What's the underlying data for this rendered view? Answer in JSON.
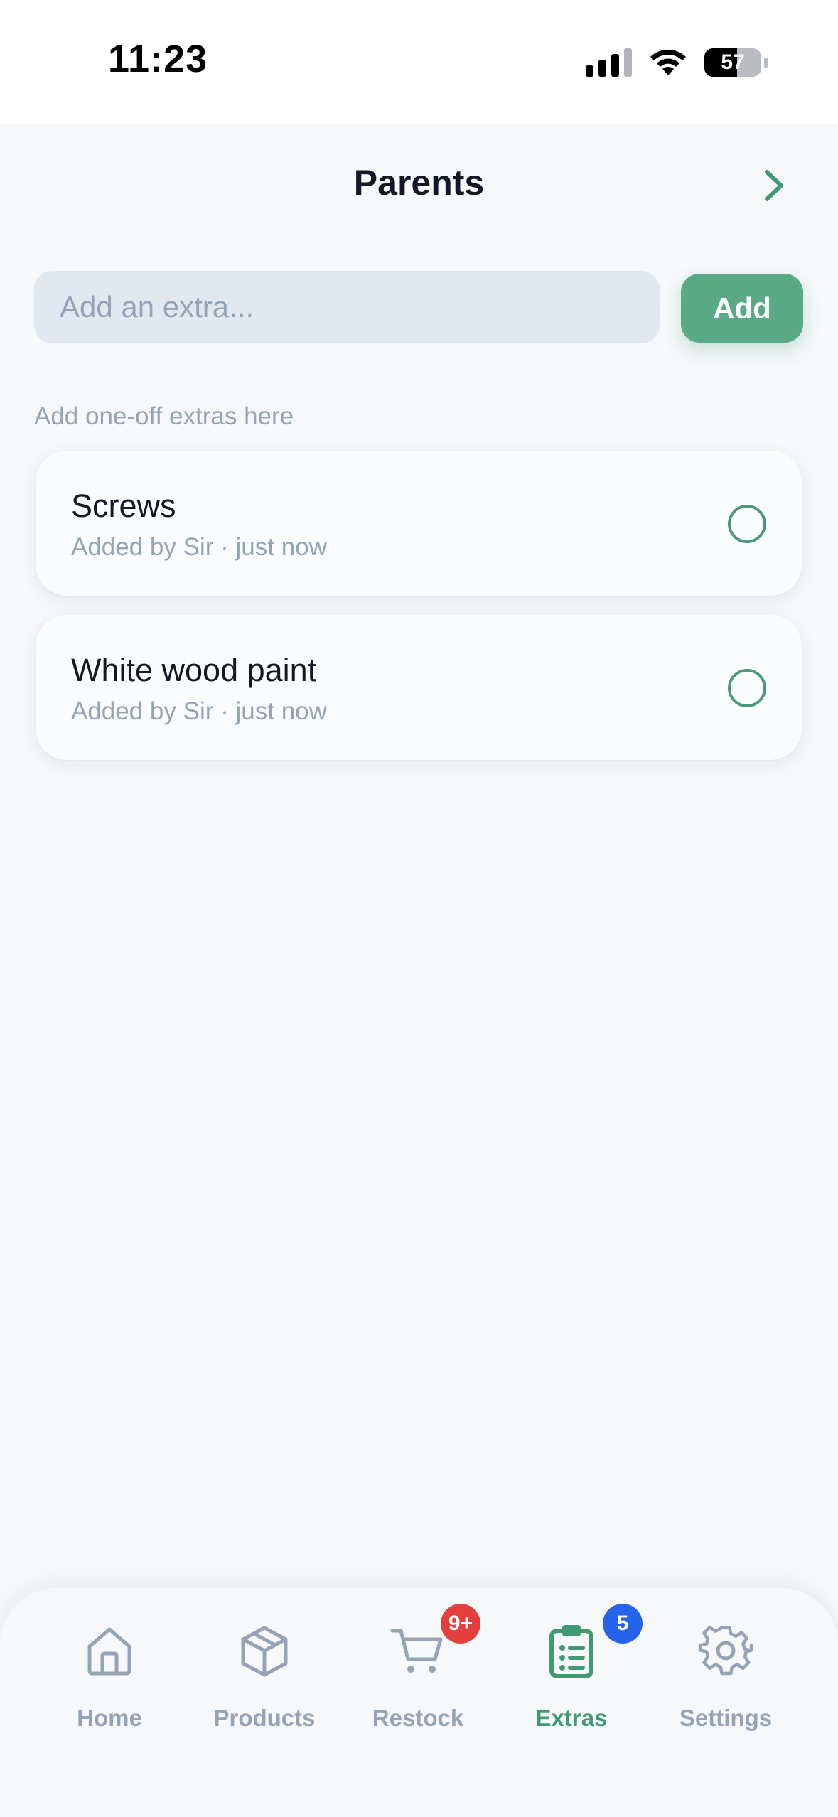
{
  "status_bar": {
    "time": "11:23",
    "battery": "57",
    "battery_level": 0.57
  },
  "header": {
    "title": "Parents"
  },
  "add_extra": {
    "placeholder": "Add an extra...",
    "button_label": "Add"
  },
  "hint": "Add one-off extras here",
  "extras": [
    {
      "name": "Screws",
      "meta": "Added by Sir · just now",
      "done": false
    },
    {
      "name": "White wood paint",
      "meta": "Added by Sir · just now",
      "done": false
    }
  ],
  "tabs": [
    {
      "label": "Home",
      "icon": "home-icon",
      "active": false,
      "badge": ""
    },
    {
      "label": "Products",
      "icon": "box-icon",
      "active": false,
      "badge": ""
    },
    {
      "label": "Restock",
      "icon": "cart-icon",
      "active": false,
      "badge": "9+"
    },
    {
      "label": "Extras",
      "icon": "clipboard-list-icon",
      "active": true,
      "badge": "5"
    },
    {
      "label": "Settings",
      "icon": "gear-icon",
      "active": false,
      "badge": ""
    }
  ],
  "colors": {
    "accent": "#5aaa85",
    "accent_text": "#3f9a73",
    "inactive": "#94a3b8",
    "badge_red": "#e53e3e",
    "badge_blue": "#2563eb"
  }
}
